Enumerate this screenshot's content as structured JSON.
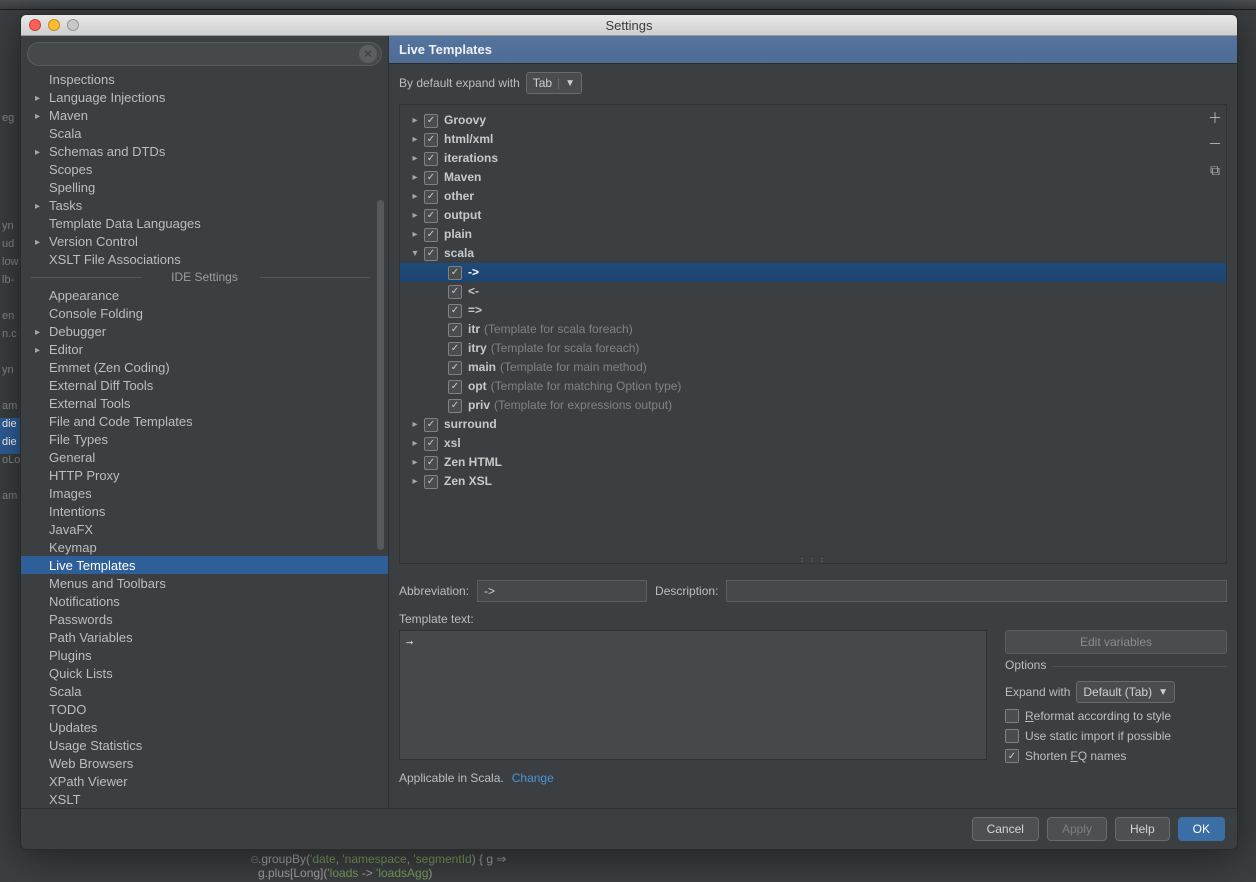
{
  "window": {
    "title": "Settings"
  },
  "sidebar": {
    "items": [
      {
        "label": "Inspections",
        "arrow": false
      },
      {
        "label": "Language Injections",
        "arrow": true
      },
      {
        "label": "Maven",
        "arrow": true
      },
      {
        "label": "Scala",
        "arrow": false
      },
      {
        "label": "Schemas and DTDs",
        "arrow": true
      },
      {
        "label": "Scopes",
        "arrow": false
      },
      {
        "label": "Spelling",
        "arrow": false
      },
      {
        "label": "Tasks",
        "arrow": true
      },
      {
        "label": "Template Data Languages",
        "arrow": false
      },
      {
        "label": "Version Control",
        "arrow": true
      },
      {
        "label": "XSLT File Associations",
        "arrow": false
      }
    ],
    "divider": "IDE Settings",
    "items2": [
      {
        "label": "Appearance",
        "arrow": false
      },
      {
        "label": "Console Folding",
        "arrow": false
      },
      {
        "label": "Debugger",
        "arrow": true
      },
      {
        "label": "Editor",
        "arrow": true
      },
      {
        "label": "Emmet (Zen Coding)",
        "arrow": false
      },
      {
        "label": "External Diff Tools",
        "arrow": false
      },
      {
        "label": "External Tools",
        "arrow": false
      },
      {
        "label": "File and Code Templates",
        "arrow": false
      },
      {
        "label": "File Types",
        "arrow": false
      },
      {
        "label": "General",
        "arrow": false
      },
      {
        "label": "HTTP Proxy",
        "arrow": false
      },
      {
        "label": "Images",
        "arrow": false
      },
      {
        "label": "Intentions",
        "arrow": false
      },
      {
        "label": "JavaFX",
        "arrow": false
      },
      {
        "label": "Keymap",
        "arrow": false
      },
      {
        "label": "Live Templates",
        "arrow": false,
        "selected": true
      },
      {
        "label": "Menus and Toolbars",
        "arrow": false
      },
      {
        "label": "Notifications",
        "arrow": false
      },
      {
        "label": "Passwords",
        "arrow": false
      },
      {
        "label": "Path Variables",
        "arrow": false
      },
      {
        "label": "Plugins",
        "arrow": false
      },
      {
        "label": "Quick Lists",
        "arrow": false
      },
      {
        "label": "Scala",
        "arrow": false
      },
      {
        "label": "TODO",
        "arrow": false
      },
      {
        "label": "Updates",
        "arrow": false
      },
      {
        "label": "Usage Statistics",
        "arrow": false
      },
      {
        "label": "Web Browsers",
        "arrow": false
      },
      {
        "label": "XPath Viewer",
        "arrow": false
      },
      {
        "label": "XSLT",
        "arrow": false
      }
    ]
  },
  "main": {
    "title": "Live Templates",
    "expand_label": "By default expand with",
    "expand_value": "Tab",
    "groups": [
      {
        "name": "Groovy",
        "open": false
      },
      {
        "name": "html/xml",
        "open": false
      },
      {
        "name": "iterations",
        "open": false
      },
      {
        "name": "Maven",
        "open": false
      },
      {
        "name": "other",
        "open": false
      },
      {
        "name": "output",
        "open": false
      },
      {
        "name": "plain",
        "open": false
      },
      {
        "name": "scala",
        "open": true,
        "children": [
          {
            "name": "->",
            "desc": "",
            "selected": true
          },
          {
            "name": "<-",
            "desc": ""
          },
          {
            "name": "=>",
            "desc": ""
          },
          {
            "name": "itr",
            "desc": "(Template for scala foreach)"
          },
          {
            "name": "itry",
            "desc": "(Template for scala foreach)"
          },
          {
            "name": "main",
            "desc": "(Template for main method)"
          },
          {
            "name": "opt",
            "desc": "(Template for matching Option type)"
          },
          {
            "name": "priv",
            "desc": "(Template for expressions output)"
          }
        ]
      },
      {
        "name": "surround",
        "open": false
      },
      {
        "name": "xsl",
        "open": false
      },
      {
        "name": "Zen HTML",
        "open": false
      },
      {
        "name": "Zen XSL",
        "open": false
      }
    ],
    "abbrev_label": "Abbreviation:",
    "abbrev_value": "->",
    "desc_label": "Description:",
    "desc_value": "",
    "template_label": "Template text:",
    "template_text": "→",
    "edit_vars": "Edit variables",
    "options_title": "Options",
    "expandwith_label": "Expand with",
    "expandwith_value": "Default (Tab)",
    "opt_reformat": "Reformat according to style",
    "opt_static": "Use static import if possible",
    "opt_shorten": "Shorten FQ names",
    "applicable": "Applicable in Scala.",
    "change": "Change"
  },
  "footer": {
    "cancel": "Cancel",
    "apply": "Apply",
    "help": "Help",
    "ok": "OK"
  },
  "bgcode": {
    "line1_a": ".groupBy(",
    "line1_b": "'date",
    "line1_c": ", ",
    "line1_d": "'namespace",
    "line1_e": ", ",
    "line1_f": "'segmentId",
    "line1_g": ") { g ⇒",
    "line2_a": "  g.plus[Long](",
    "line2_b": "'loads",
    "line2_c": " -> ",
    "line2_d": "'loadsAgg",
    "line2_e": ")"
  }
}
